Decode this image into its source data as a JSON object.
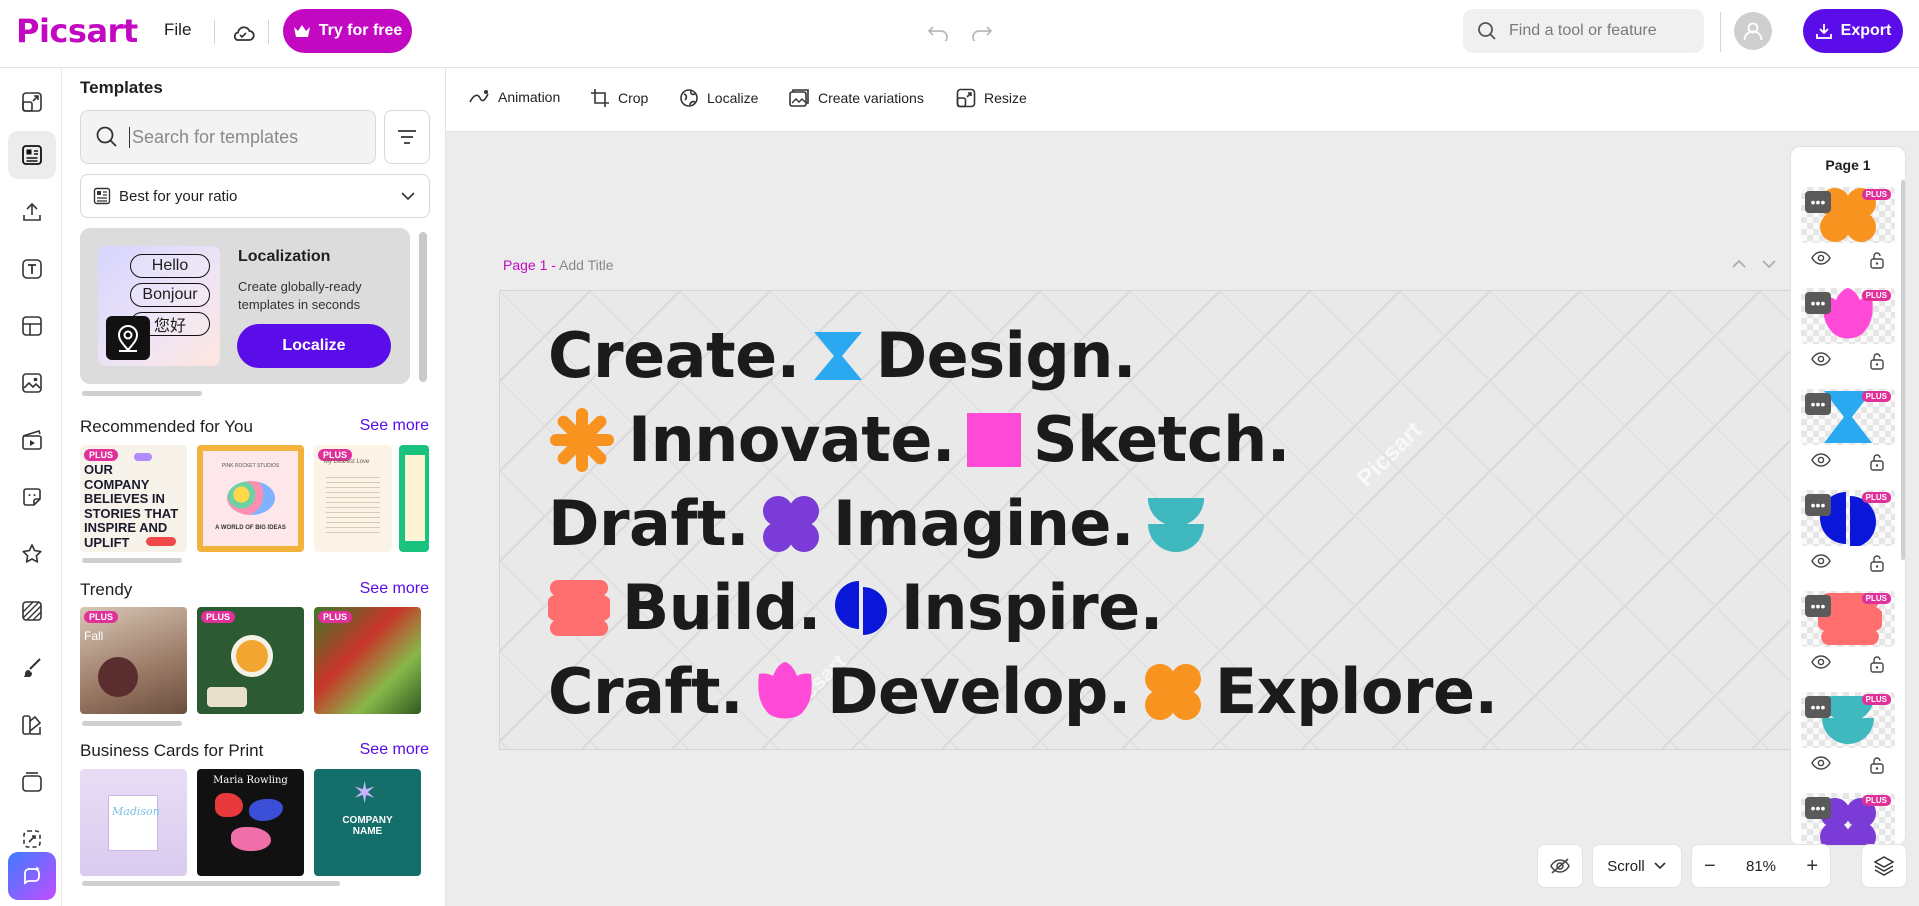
{
  "app": {
    "logo": "Picsart",
    "file_menu": "File",
    "try_button": "Try for free",
    "search_placeholder": "Find a tool or feature",
    "export_button": "Export"
  },
  "rail": {
    "icons": [
      "resize-icon",
      "templates-icon",
      "upload-icon",
      "text-icon",
      "layout-icon",
      "photos-icon",
      "video-icon",
      "stickers-icon",
      "favorites-icon",
      "background-icon",
      "draw-icon",
      "brand-icon",
      "folder-icon",
      "batch-icon",
      "ai-icon"
    ],
    "active_index": 1
  },
  "templates_panel": {
    "title": "Templates",
    "search_placeholder": "Search for templates",
    "ratio_label": "Best for your ratio",
    "localization_card": {
      "pills": [
        "Hello",
        "Bonjour",
        "您好"
      ],
      "title": "Localization",
      "description": "Create globally-ready templates in seconds",
      "button": "Localize"
    },
    "sections": [
      {
        "title": "Recommended for You",
        "see_more": "See more",
        "thumbs": [
          {
            "lines": [
              "OUR",
              "COMPANY",
              "BELIEVES IN",
              "STORIES THAT",
              "INSPIRE AND",
              "UPLIFT"
            ],
            "badge": "PLUS"
          },
          {
            "top": "PINK ROCKET STUDIOS",
            "bottom": "A WORLD OF BIG IDEAS"
          },
          {
            "top": "My Dearest Love",
            "badge": "PLUS"
          },
          {}
        ]
      },
      {
        "title": "Trendy",
        "see_more": "See more",
        "thumbs": [
          {
            "label": "Fall",
            "badge": "PLUS"
          },
          {
            "badge": "PLUS"
          },
          {
            "badge": "PLUS"
          }
        ]
      },
      {
        "title": "Business Cards for Print",
        "see_more": "See more",
        "thumbs": [
          {
            "name": "Madison"
          },
          {
            "name": "Maria Rowling"
          },
          {
            "name": "COMPANY NAME"
          }
        ]
      }
    ]
  },
  "editor_toolbar": {
    "tools": [
      "Animation",
      "Crop",
      "Localize",
      "Create variations",
      "Resize"
    ]
  },
  "canvas": {
    "page_label": "Page 1 - ",
    "add_title": "Add Title",
    "lines": [
      [
        "Create.",
        "Design."
      ],
      [
        "Innovate.",
        "Sketch."
      ],
      [
        "Draft.",
        "Imagine."
      ],
      [
        "Build.",
        "Inspire."
      ],
      [
        "Craft.",
        "Develop.",
        "Explore."
      ]
    ],
    "watermark": "Picsart"
  },
  "pages_panel": {
    "title": "Page 1",
    "layer_badge": "PLUS",
    "layer_more": "•••",
    "layer_colors": [
      "#f7931e",
      "#ff4ad8",
      "#2aa9f0",
      "#0a17d9",
      "#ff6f6f",
      "#3fb8c0",
      "#7a3bd6"
    ]
  },
  "bottom": {
    "view_mode": "Scroll",
    "zoom": "81%"
  },
  "colors": {
    "brand": "#c209c1",
    "accent": "#5a0de8",
    "orange": "#f7931e",
    "blue": "#2aa9f0",
    "pink": "#ff4ad8",
    "purple": "#7a3bd6",
    "teal": "#3fb8c0",
    "coral": "#ff6f6f",
    "deep_blue": "#0a17d9"
  }
}
